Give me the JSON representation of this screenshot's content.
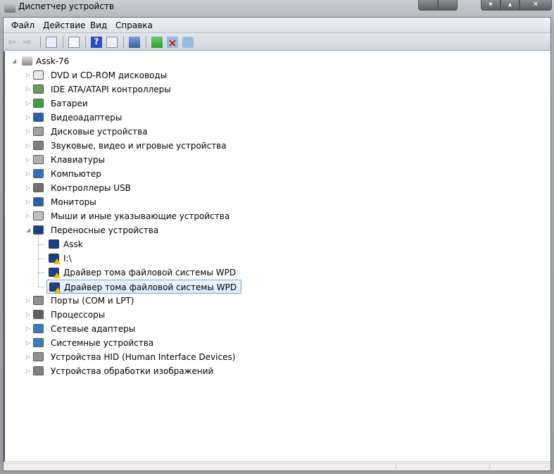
{
  "window": {
    "title": "Диспетчер устройств",
    "minimize": "▾",
    "maximize": "▴",
    "close": "✕"
  },
  "menu": [
    "Файл",
    "Действие",
    "Вид",
    "Справка"
  ],
  "toolbar": [
    "back",
    "forward",
    "show-hide-console-tree",
    "properties",
    "help",
    "show-action-pane",
    "scan-hardware",
    "update-driver",
    "uninstall",
    "disable"
  ],
  "tree": {
    "root": "Assk-76",
    "categories": [
      {
        "label": "DVD и CD-ROM дисководы",
        "icon": "dvd-icon",
        "color": "#e8e8e8"
      },
      {
        "label": "IDE ATA/ATAPI контроллеры",
        "icon": "ide-icon",
        "color": "#6a9a5a"
      },
      {
        "label": "Батареи",
        "icon": "battery-icon",
        "color": "#3aa33a"
      },
      {
        "label": "Видеоадаптеры",
        "icon": "display-adapter-icon",
        "color": "#2a5fb0"
      },
      {
        "label": "Дисковые устройства",
        "icon": "disk-icon",
        "color": "#a0a0a0"
      },
      {
        "label": "Звуковые, видео и игровые устройства",
        "icon": "speaker-icon",
        "color": "#808080"
      },
      {
        "label": "Клавиатуры",
        "icon": "keyboard-icon",
        "color": "#b0b0b0"
      },
      {
        "label": "Компьютер",
        "icon": "computer-icon",
        "color": "#3070c0"
      },
      {
        "label": "Контроллеры USB",
        "icon": "usb-icon",
        "color": "#707070"
      },
      {
        "label": "Мониторы",
        "icon": "monitor-icon",
        "color": "#2a5fb0"
      },
      {
        "label": "Мыши и иные указывающие устройства",
        "icon": "mouse-icon",
        "color": "#c0c0c0"
      },
      {
        "label": "Переносные устройства",
        "icon": "portable-device-icon",
        "color": "#1c3f8a",
        "expanded": true,
        "children": [
          {
            "label": "Assk",
            "warning": false
          },
          {
            "label": "I:\\",
            "warning": true
          },
          {
            "label": "Драйвер тома файловой системы WPD",
            "warning": true
          },
          {
            "label": "Драйвер тома файловой системы WPD",
            "warning": true,
            "selected": true
          }
        ]
      },
      {
        "label": "Порты (COM и LPT)",
        "icon": "port-icon",
        "color": "#909090"
      },
      {
        "label": "Процессоры",
        "icon": "processor-icon",
        "color": "#606060"
      },
      {
        "label": "Сетевые адаптеры",
        "icon": "network-icon",
        "color": "#3a7ac0"
      },
      {
        "label": "Системные устройства",
        "icon": "system-icon",
        "color": "#3a7ac0"
      },
      {
        "label": "Устройства HID (Human Interface Devices)",
        "icon": "hid-icon",
        "color": "#909090"
      },
      {
        "label": "Устройства обработки изображений",
        "icon": "camera-icon",
        "color": "#808080"
      }
    ]
  }
}
